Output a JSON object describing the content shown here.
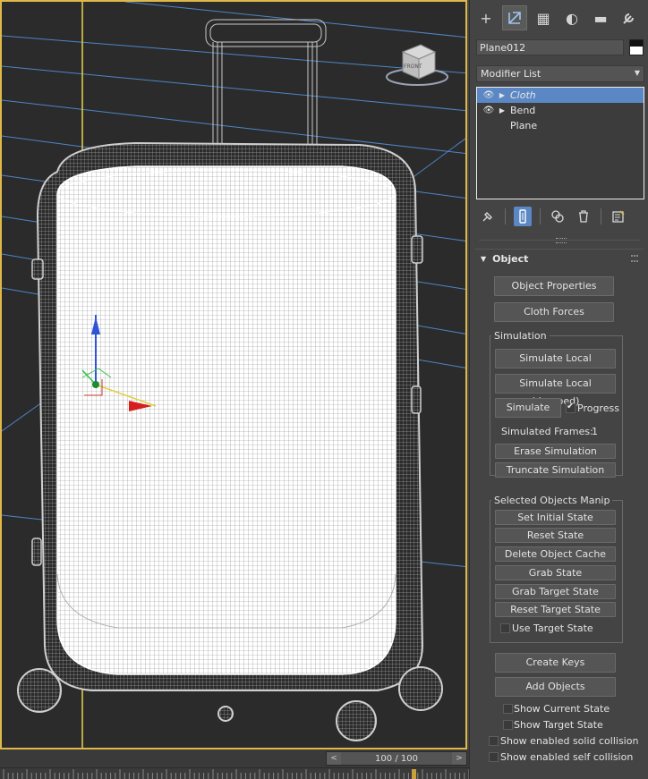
{
  "viewport": {
    "gizmo_label": "FRONT"
  },
  "timeline": {
    "readout": "100 / 100",
    "prev_arrow": "<",
    "next_arrow": ">"
  },
  "panel": {
    "tabs": [
      {
        "icon": "create-icon",
        "glyph": "+"
      },
      {
        "icon": "modify-icon",
        "glyph": "⌗"
      },
      {
        "icon": "hierarchy-icon",
        "glyph": "▦"
      },
      {
        "icon": "motion-icon",
        "glyph": "◐"
      },
      {
        "icon": "display-icon",
        "glyph": "▬"
      },
      {
        "icon": "utilities-icon",
        "glyph": "🔧"
      }
    ],
    "object_name": "Plane012",
    "modifier_list": "Modifier List",
    "stack": [
      {
        "label": "Cloth",
        "eye": true,
        "expand": true,
        "selected": true
      },
      {
        "label": "Bend",
        "eye": true,
        "expand": true,
        "selected": false
      },
      {
        "label": "Plane",
        "eye": false,
        "expand": false,
        "selected": false
      }
    ]
  },
  "rollout": {
    "title": "Object",
    "object_properties": "Object Properties",
    "cloth_forces": "Cloth Forces",
    "simulation_group": "Simulation",
    "simulate_local": "Simulate Local",
    "simulate_local_damped": "Simulate Local (damped)",
    "simulate": "Simulate",
    "progress": "Progress",
    "progress_checked": true,
    "simulated_frames_label": "Simulated Frames:",
    "simulated_frames_value": "1",
    "erase_simulation": "Erase Simulation",
    "truncate_simulation": "Truncate Simulation",
    "manip_group": "Selected Objects Manip",
    "set_initial_state": "Set Initial State",
    "reset_state": "Reset State",
    "delete_object_cache": "Delete Object Cache",
    "grab_state": "Grab State",
    "grab_target_state": "Grab Target State",
    "reset_target_state": "Reset Target State",
    "use_target_state": "Use Target State",
    "create_keys": "Create Keys",
    "add_objects": "Add Objects",
    "show_current_state": "Show Current State",
    "show_target_state": "Show Target State",
    "show_solid_collision": "Show enabled solid collision",
    "show_self_collision": "Show enabled self collision"
  }
}
